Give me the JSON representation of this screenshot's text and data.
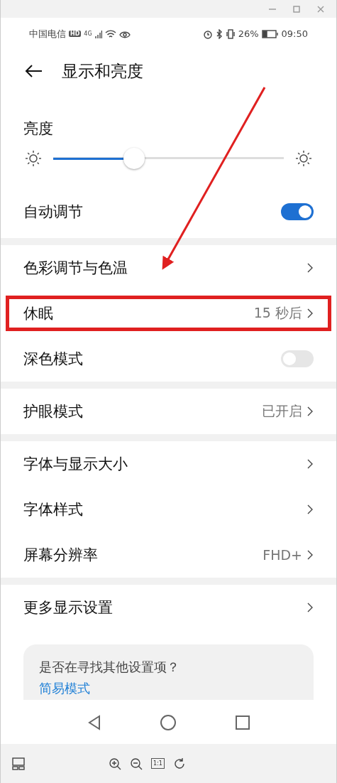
{
  "status_bar": {
    "carrier": "中国电信",
    "hd_badge": "HD",
    "network": "4G",
    "battery_percent": "26%",
    "time": "09:50"
  },
  "header": {
    "title": "显示和亮度"
  },
  "brightness": {
    "label": "亮度",
    "level": 0.35
  },
  "groups": [
    {
      "rows": [
        {
          "kind": "toggle",
          "label": "自动调节",
          "on": true
        }
      ]
    },
    {
      "rows": [
        {
          "kind": "link",
          "label": "色彩调节与色温"
        },
        {
          "kind": "link",
          "label": "休眠",
          "value": "15 秒后",
          "highlighted": true
        },
        {
          "kind": "toggle",
          "label": "深色模式",
          "on": false
        }
      ]
    },
    {
      "rows": [
        {
          "kind": "link",
          "label": "护眼模式",
          "value": "已开启"
        }
      ]
    },
    {
      "rows": [
        {
          "kind": "link",
          "label": "字体与显示大小"
        },
        {
          "kind": "link",
          "label": "字体样式"
        },
        {
          "kind": "link",
          "label": "屏幕分辨率",
          "value": "FHD+"
        }
      ]
    },
    {
      "rows": [
        {
          "kind": "link",
          "label": "更多显示设置"
        }
      ]
    }
  ],
  "suggestion_card": {
    "question": "是否在寻找其他设置项？",
    "link": "简易模式"
  },
  "viewer_toolbar": {
    "actual_size": "1:1"
  }
}
